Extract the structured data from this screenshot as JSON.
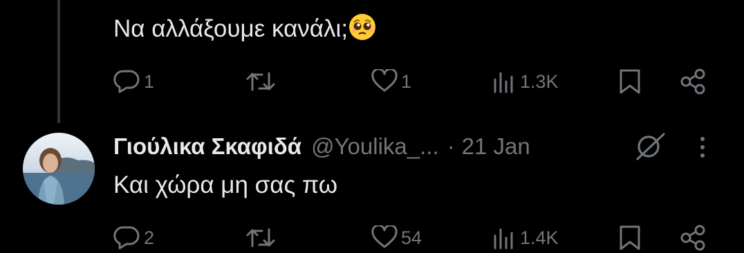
{
  "tweet1": {
    "text": "Να αλλάξουμε κανάλι;",
    "emoji": "pleading-face",
    "actions": {
      "replies": "1",
      "retweets": "",
      "likes": "1",
      "views": "1.3K"
    }
  },
  "tweet2": {
    "display_name": "Γιούλικα Σκαφιδά",
    "handle": "@Youlika_...",
    "separator": "·",
    "date": "21 Jan",
    "text": "Και χώρα μη σας πω",
    "actions": {
      "replies": "2",
      "retweets": "",
      "likes": "54",
      "views": "1.4K"
    }
  },
  "colors": {
    "background": "#000000",
    "text": "#e7e9ea",
    "muted": "#71767b",
    "thread_line": "#333639"
  }
}
